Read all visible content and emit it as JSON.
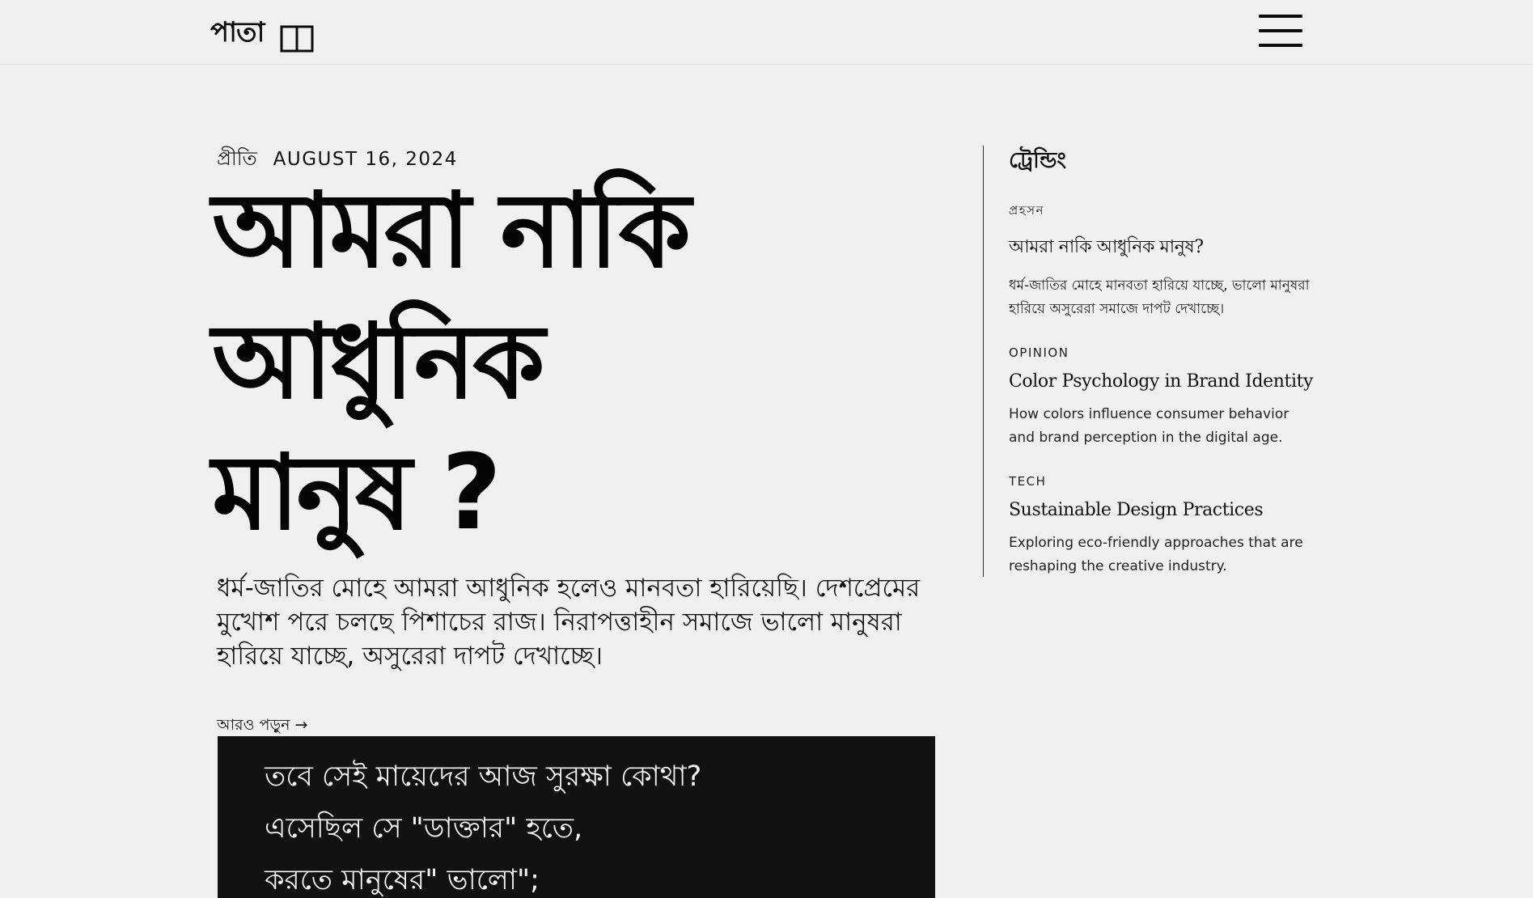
{
  "header": {
    "logo_text": "পাতা",
    "logo_icon": "book-icon",
    "menu_icon": "hamburger-menu-icon"
  },
  "article": {
    "author": "প্রীতি",
    "date": "AUGUST 16, 2024",
    "title_line1": "আমরা নাকি",
    "title_line2": "আধুনিক",
    "title_line3": "মানুষ ?",
    "excerpt": "ধর্ম-জাতির মোহে আমরা আধুনিক হলেও মানবতা হারিয়েছি। দেশপ্রেমের মুখোশ পরে চলছে পিশাচের রাজ। নিরাপত্তাহীন সমাজে ভালো মানুষরা হারিয়ে যাচ্ছে, অসুরেরা দাপট দেখাচ্ছে।",
    "read_more": "আরও পড়ুন →",
    "quote_lines": [
      "তবে সেই মায়েদের আজ সুরক্ষা কোথা?",
      "এসেছিল সে \"ডাক্তার\" হতে,",
      "করতে মানুষের\" ভালো\";"
    ]
  },
  "trending": {
    "title": "ট্রেন্ডিং",
    "items": [
      {
        "category": "প্রহসন",
        "headline": "আমরা নাকি আধুনিক মানুষ?",
        "description": "ধর্ম-জাতির মোহে মানবতা হারিয়ে যাচ্ছে, ভালো মানুষরা হারিয়ে অসুরেরা সমাজে দাপট দেখাচ্ছে।"
      },
      {
        "category": "OPINION",
        "headline": "Color Psychology in Brand Identity",
        "description": "How colors influence consumer behavior and brand perception in the digital age."
      },
      {
        "category": "TECH",
        "headline": "Sustainable Design Practices",
        "description": "Exploring eco-friendly approaches that are reshaping the creative industry."
      }
    ]
  },
  "colors": {
    "background": "#f0f0f0",
    "text": "#0c0c0c",
    "quote_background": "#111111",
    "quote_text": "#f4f4f4"
  }
}
